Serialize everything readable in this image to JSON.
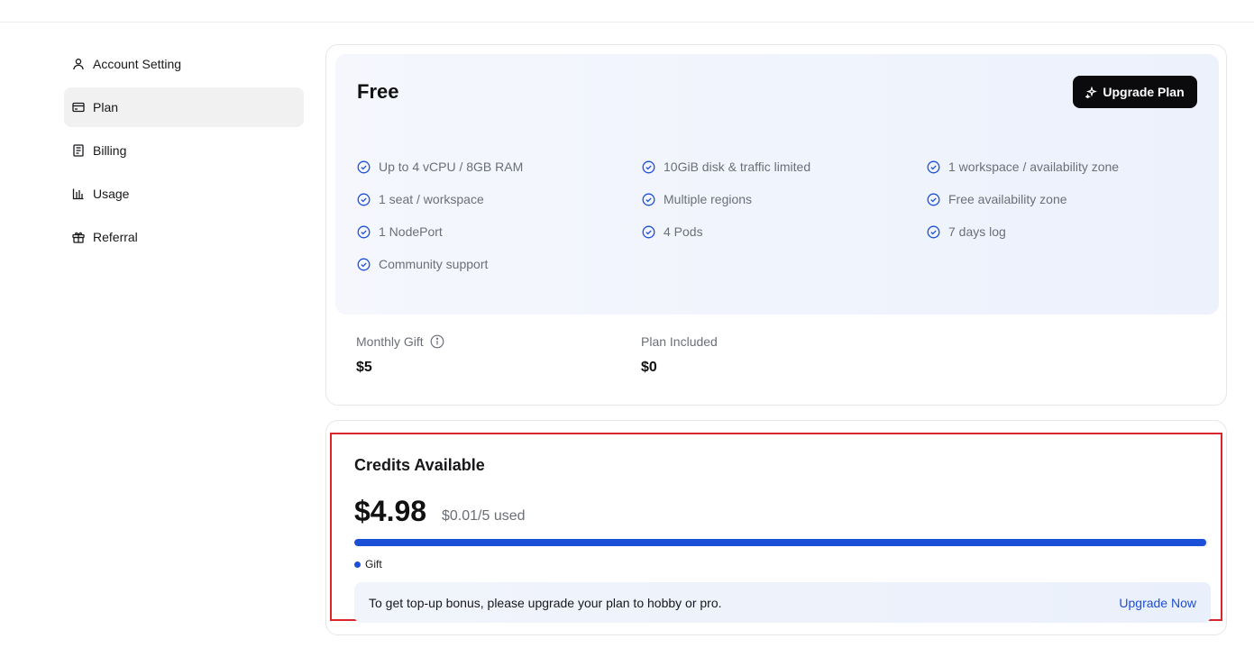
{
  "sidebar": {
    "items": [
      {
        "label": "Account Setting",
        "icon": "user-icon",
        "active": false
      },
      {
        "label": "Plan",
        "icon": "credit-card-icon",
        "active": true
      },
      {
        "label": "Billing",
        "icon": "receipt-icon",
        "active": false
      },
      {
        "label": "Usage",
        "icon": "bar-chart-icon",
        "active": false
      },
      {
        "label": "Referral",
        "icon": "gift-icon",
        "active": false
      }
    ]
  },
  "plan": {
    "name": "Free",
    "upgrade_label": "Upgrade Plan",
    "features": [
      "Up to 4 vCPU / 8GB RAM",
      "10GiB disk & traffic limited",
      "1 workspace / availability zone",
      "1 seat / workspace",
      "Multiple regions",
      "Free availability zone",
      "1 NodePort",
      "4 Pods",
      "7 days log",
      "Community support"
    ],
    "monthly_gift_label": "Monthly Gift",
    "monthly_gift_value": "$5",
    "plan_included_label": "Plan Included",
    "plan_included_value": "$0"
  },
  "credits": {
    "title": "Credits Available",
    "amount": "$4.98",
    "used": "$0.01/5 used",
    "progress_remaining_fraction": 0.998,
    "legend_label": "Gift",
    "banner_text": "To get top-up bonus, please upgrade your plan to hobby or pro.",
    "banner_action": "Upgrade Now"
  },
  "colors": {
    "accent": "#1c4fd8",
    "dark_button": "#0b0b0d",
    "highlight_border": "#d9262c"
  }
}
